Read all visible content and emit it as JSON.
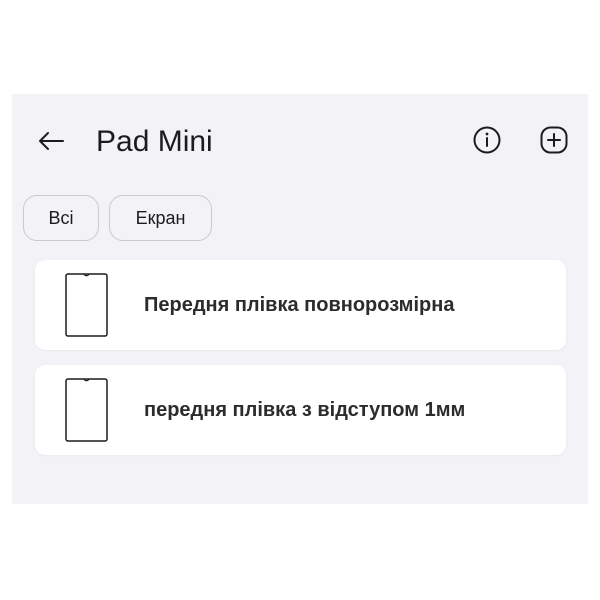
{
  "header": {
    "title": "Pad Mini",
    "back_icon": "arrow-left-icon",
    "info_icon": "info-circle-icon",
    "add_icon": "plus-square-icon"
  },
  "filters": [
    {
      "label": "Всі"
    },
    {
      "label": "Екран"
    }
  ],
  "items": [
    {
      "label": "Передня плівка повнорозмірна",
      "icon": "tablet-icon"
    },
    {
      "label": "передня плівка з відступом 1мм",
      "icon": "tablet-icon"
    }
  ],
  "colors": {
    "background": "#f2f2f7",
    "card": "#ffffff",
    "text": "#1c1c1e"
  }
}
